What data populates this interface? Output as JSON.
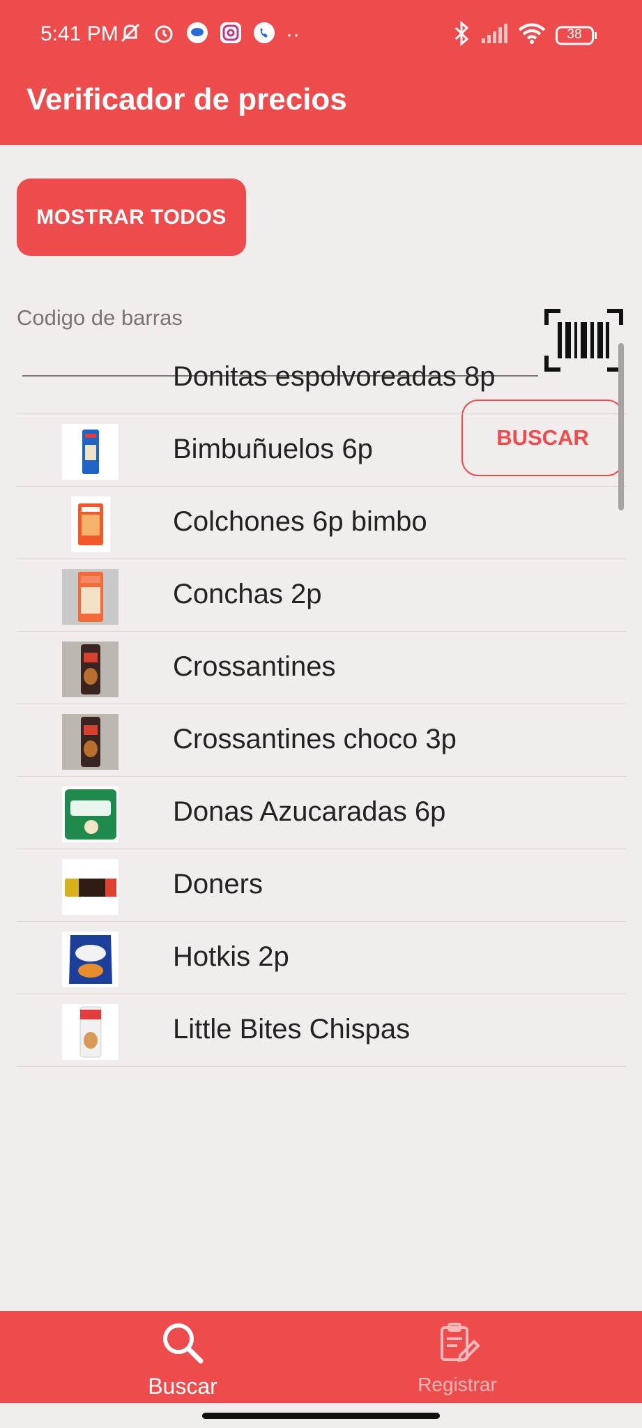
{
  "status_bar": {
    "time": "5:41 PM",
    "dots": "··",
    "battery": "38"
  },
  "app_bar": {
    "title": "Verificador de precios"
  },
  "main": {
    "show_all_label": "MOSTRAR TODOS",
    "barcode": {
      "placeholder": "Codigo de barras",
      "value": ""
    },
    "search_label": "BUSCAR"
  },
  "products": [
    {
      "name": "Donitas espolvoreadas 8p",
      "thumb": "none"
    },
    {
      "name": "Bimbuñuelos 6p",
      "thumb": "blue-pack"
    },
    {
      "name": "Colchones 6p bimbo",
      "thumb": "orange-pack"
    },
    {
      "name": "Conchas 2p",
      "thumb": "conchas-pack"
    },
    {
      "name": "Crossantines",
      "thumb": "dark-pack"
    },
    {
      "name": "Crossantines choco 3p",
      "thumb": "dark-pack"
    },
    {
      "name": "Donas Azucaradas 6p",
      "thumb": "green-pack"
    },
    {
      "name": "Doners",
      "thumb": "doners-bar"
    },
    {
      "name": "Hotkis 2p",
      "thumb": "blue-bag"
    },
    {
      "name": "Little Bites Chispas",
      "thumb": "red-pack"
    }
  ],
  "bottom_nav": {
    "search_label": "Buscar",
    "register_label": "Registrar"
  },
  "colors": {
    "primary": "#ee4b4d",
    "background": "#f2eded"
  }
}
